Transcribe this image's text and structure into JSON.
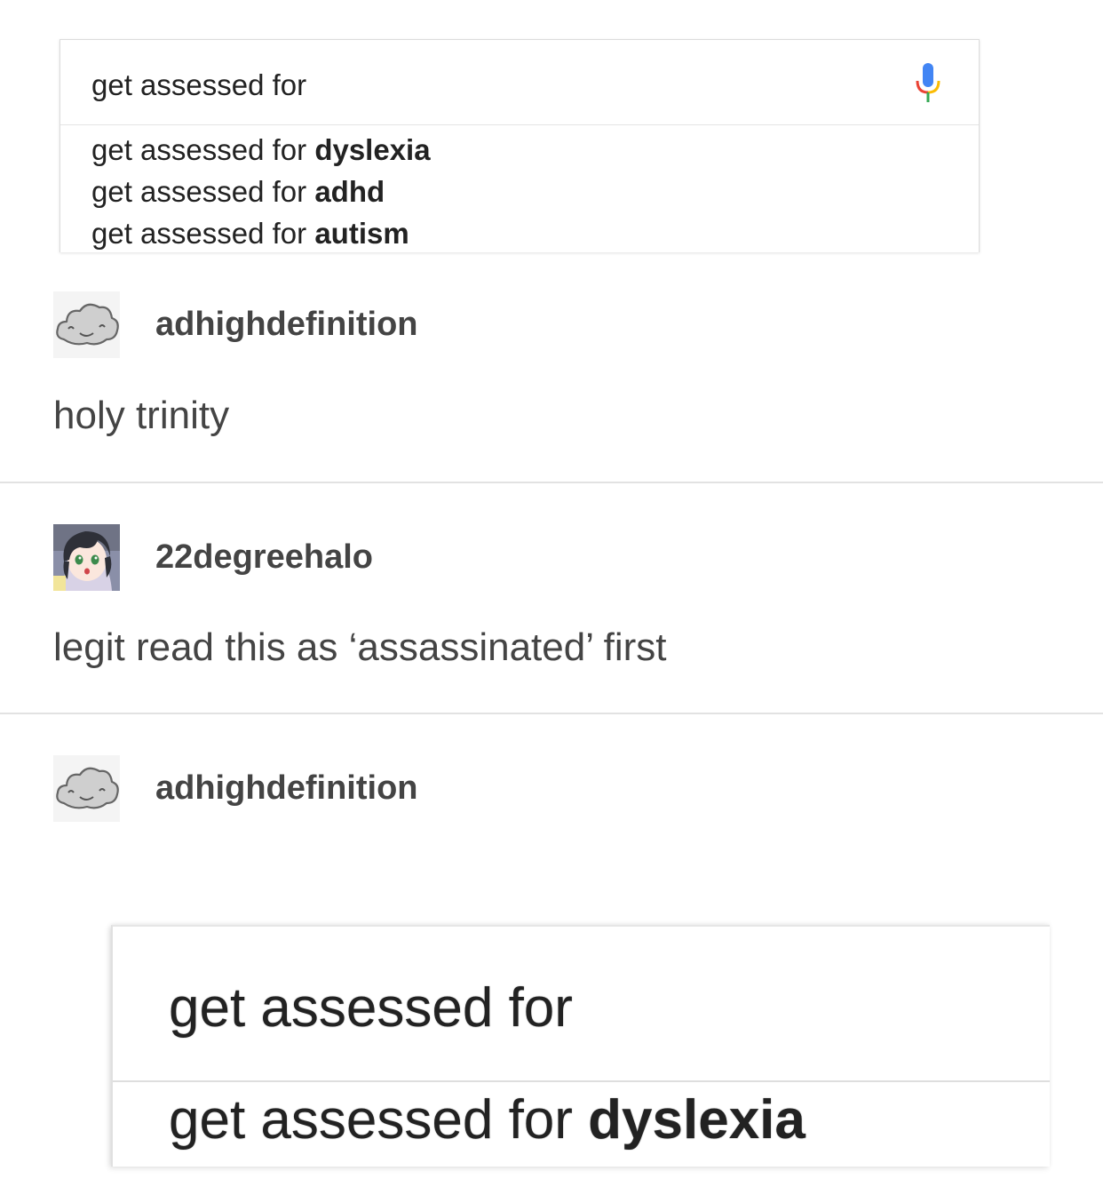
{
  "search_top": {
    "query": "get assessed for",
    "mic_icon": "microphone-icon",
    "suggestions": [
      {
        "prefix": "get assessed for ",
        "completion": "dyslexia"
      },
      {
        "prefix": "get assessed for ",
        "completion": "adhd"
      },
      {
        "prefix": "get assessed for ",
        "completion": "autism"
      }
    ]
  },
  "posts": [
    {
      "username": "adhighdefinition",
      "avatar": "cloud-avatar-icon",
      "text": "holy trinity"
    },
    {
      "username": "22degreehalo",
      "avatar": "anime-girl-avatar",
      "text": "legit read this as ‘assassinated’ first"
    },
    {
      "username": "adhighdefinition",
      "avatar": "cloud-avatar-icon",
      "text": ""
    }
  ],
  "search_zoom": {
    "query": "get assessed for",
    "suggestion_prefix": "get assessed for ",
    "suggestion_completion": "dyslexia"
  },
  "colors": {
    "text": "#444444",
    "divider": "#e2e2e2",
    "mic_blue": "#4285f4",
    "mic_red": "#ea4335",
    "mic_green": "#34a853",
    "mic_yellow": "#fbbc05"
  }
}
